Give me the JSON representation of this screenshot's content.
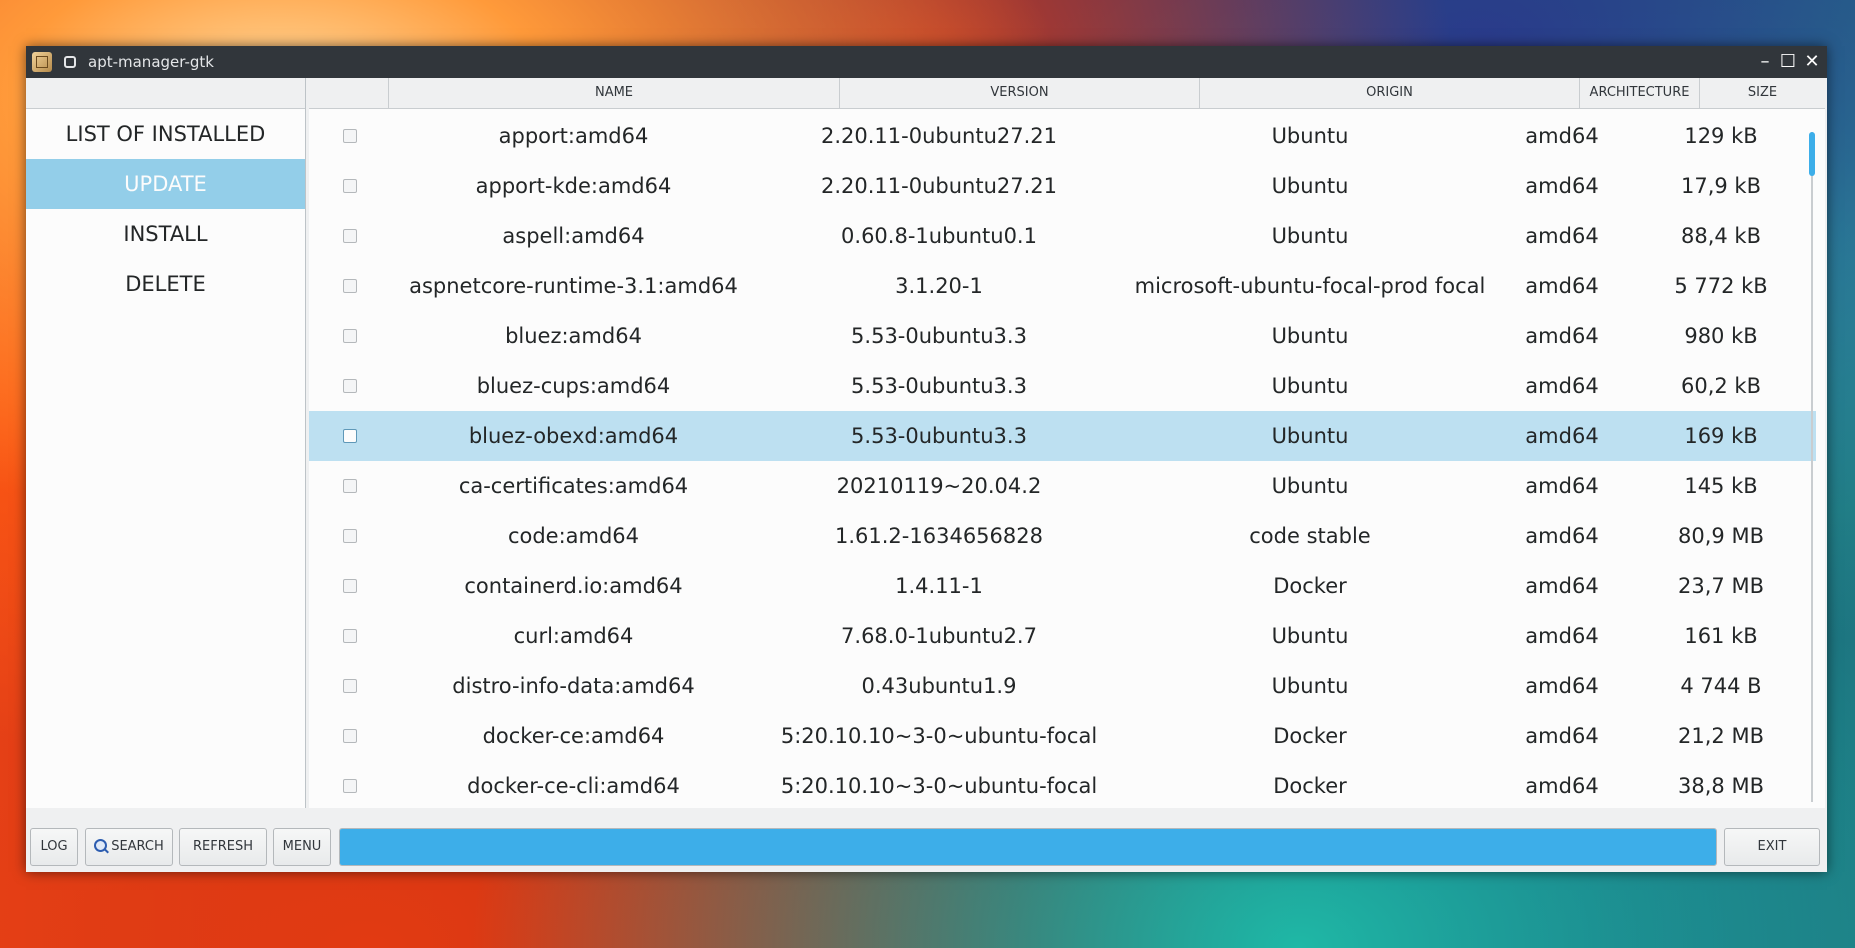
{
  "window": {
    "title": "apt-manager-gtk",
    "minimize": "–",
    "maximize": "☐",
    "close": "✕"
  },
  "sidebar": {
    "items": [
      {
        "label": "LIST OF INSTALLED",
        "active": false
      },
      {
        "label": "UPDATE",
        "active": true
      },
      {
        "label": "INSTALL",
        "active": false
      },
      {
        "label": "DELETE",
        "active": false
      }
    ]
  },
  "table": {
    "headers": {
      "name": "NAME",
      "version": "VERSION",
      "origin": "ORIGIN",
      "architecture": "ARCHITECTURE",
      "size": "SIZE"
    },
    "rows": [
      {
        "name": "apport:amd64",
        "version": "2.20.11-0ubuntu27.21",
        "origin": "Ubuntu",
        "arch": "amd64",
        "size": "129 kB"
      },
      {
        "name": "apport-kde:amd64",
        "version": "2.20.11-0ubuntu27.21",
        "origin": "Ubuntu",
        "arch": "amd64",
        "size": "17,9 kB"
      },
      {
        "name": "aspell:amd64",
        "version": "0.60.8-1ubuntu0.1",
        "origin": "Ubuntu",
        "arch": "amd64",
        "size": "88,4 kB"
      },
      {
        "name": "aspnetcore-runtime-3.1:amd64",
        "version": "3.1.20-1",
        "origin": "microsoft-ubuntu-focal-prod focal",
        "arch": "amd64",
        "size": "5 772 kB"
      },
      {
        "name": "bluez:amd64",
        "version": "5.53-0ubuntu3.3",
        "origin": "Ubuntu",
        "arch": "amd64",
        "size": "980 kB"
      },
      {
        "name": "bluez-cups:amd64",
        "version": "5.53-0ubuntu3.3",
        "origin": "Ubuntu",
        "arch": "amd64",
        "size": "60,2 kB"
      },
      {
        "name": "bluez-obexd:amd64",
        "version": "5.53-0ubuntu3.3",
        "origin": "Ubuntu",
        "arch": "amd64",
        "size": "169 kB"
      },
      {
        "name": "ca-certificates:amd64",
        "version": "20210119~20.04.2",
        "origin": "Ubuntu",
        "arch": "amd64",
        "size": "145 kB"
      },
      {
        "name": "code:amd64",
        "version": "1.61.2-1634656828",
        "origin": "code stable",
        "arch": "amd64",
        "size": "80,9 MB"
      },
      {
        "name": "containerd.io:amd64",
        "version": "1.4.11-1",
        "origin": "Docker",
        "arch": "amd64",
        "size": "23,7 MB"
      },
      {
        "name": "curl:amd64",
        "version": "7.68.0-1ubuntu2.7",
        "origin": "Ubuntu",
        "arch": "amd64",
        "size": "161 kB"
      },
      {
        "name": "distro-info-data:amd64",
        "version": "0.43ubuntu1.9",
        "origin": "Ubuntu",
        "arch": "amd64",
        "size": "4 744 B"
      },
      {
        "name": "docker-ce:amd64",
        "version": "5:20.10.10~3-0~ubuntu-focal",
        "origin": "Docker",
        "arch": "amd64",
        "size": "21,2 MB"
      },
      {
        "name": "docker-ce-cli:amd64",
        "version": "5:20.10.10~3-0~ubuntu-focal",
        "origin": "Docker",
        "arch": "amd64",
        "size": "38,8 MB"
      }
    ],
    "selected_row": "bluez-obexd:amd64"
  },
  "scroll": {
    "position": 0.0
  },
  "toolbar": {
    "log": "LOG",
    "search": "SEARCH",
    "refresh": "REFRESH",
    "menu": "MENU",
    "exit": "EXIT"
  },
  "progress": {
    "fraction": 1.0
  },
  "colors": {
    "accent": "#3daee9",
    "sidebar_active": "#93cee9",
    "row_selected": "#bde0f1",
    "titlebar": "#31363b"
  }
}
